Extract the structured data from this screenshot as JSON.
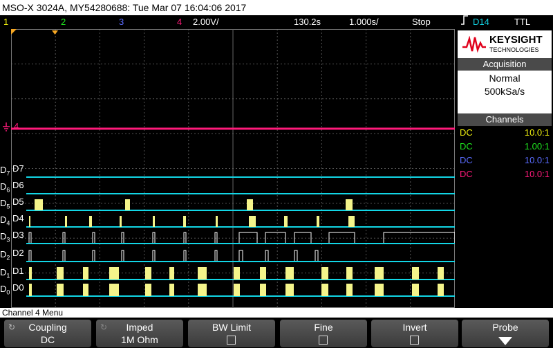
{
  "titlebar": {
    "text": "MSO-X 3024A, MY54280688: Tue Mar 07 16:04:06 2017"
  },
  "status": {
    "ch1": "1",
    "ch2": "2",
    "ch3": "3",
    "ch4": "4",
    "scale": "2.00V/",
    "time_offset": "130.2s",
    "time_per_div": "1.000s/",
    "run_state": "Stop",
    "trigger_source": "D14",
    "trigger_level": "TTL"
  },
  "side": {
    "brand_name": "KEYSIGHT",
    "brand_sub": "TECHNOLOGIES",
    "acquisition_title": "Acquisition",
    "acq_mode": "Normal",
    "acq_rate": "500kSa/s",
    "channels_title": "Channels",
    "channels": [
      {
        "coupling": "DC",
        "ratio": "10.0:1",
        "color": "#f2f20f"
      },
      {
        "coupling": "DC",
        "ratio": "1.00:1",
        "color": "#1fe81f"
      },
      {
        "coupling": "DC",
        "ratio": "10.0:1",
        "color": "#5a6cff"
      },
      {
        "coupling": "DC",
        "ratio": "10.0:1",
        "color": "#ff1a7a"
      }
    ]
  },
  "grid": {
    "ch4_marker": "4",
    "digital": [
      {
        "name": "D7",
        "sub_d": "D",
        "sub": "7"
      },
      {
        "name": "D6",
        "sub_d": "D",
        "sub": "6"
      },
      {
        "name": "D5",
        "sub_d": "D",
        "sub": "5"
      },
      {
        "name": "D4",
        "sub_d": "D",
        "sub": "4"
      },
      {
        "name": "D3",
        "sub_d": "D",
        "sub": "3"
      },
      {
        "name": "D2",
        "sub_d": "D",
        "sub": "2"
      },
      {
        "name": "D1",
        "sub_d": "D",
        "sub": "1"
      },
      {
        "name": "D0",
        "sub_d": "D",
        "sub": "0"
      }
    ]
  },
  "menu": {
    "title": "Channel 4 Menu"
  },
  "softkeys": [
    {
      "label": "Coupling",
      "value": "DC"
    },
    {
      "label": "Imped",
      "value": "1M Ohm"
    },
    {
      "label": "BW Limit",
      "value": ""
    },
    {
      "label": "Fine",
      "value": ""
    },
    {
      "label": "Invert",
      "value": ""
    },
    {
      "label": "Probe",
      "value": ""
    }
  ],
  "colors": {
    "ch1": "#f2f20f",
    "ch2": "#1fe81f",
    "ch3": "#5a6cff",
    "ch4": "#ff1a7a",
    "digital": "#12d6e6",
    "pulse": "#f4f48a"
  }
}
